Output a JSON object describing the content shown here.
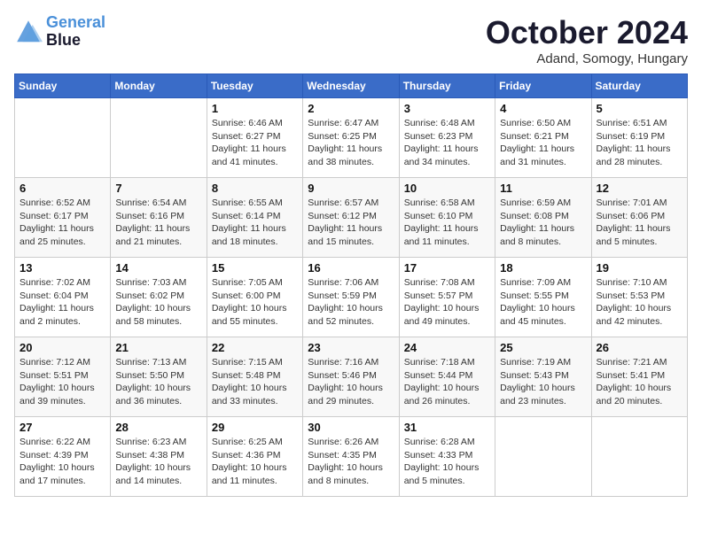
{
  "logo": {
    "line1": "General",
    "line2": "Blue"
  },
  "title": "October 2024",
  "location": "Adand, Somogy, Hungary",
  "headers": [
    "Sunday",
    "Monday",
    "Tuesday",
    "Wednesday",
    "Thursday",
    "Friday",
    "Saturday"
  ],
  "weeks": [
    [
      {
        "day": "",
        "info": ""
      },
      {
        "day": "",
        "info": ""
      },
      {
        "day": "1",
        "info": "Sunrise: 6:46 AM\nSunset: 6:27 PM\nDaylight: 11 hours and 41 minutes."
      },
      {
        "day": "2",
        "info": "Sunrise: 6:47 AM\nSunset: 6:25 PM\nDaylight: 11 hours and 38 minutes."
      },
      {
        "day": "3",
        "info": "Sunrise: 6:48 AM\nSunset: 6:23 PM\nDaylight: 11 hours and 34 minutes."
      },
      {
        "day": "4",
        "info": "Sunrise: 6:50 AM\nSunset: 6:21 PM\nDaylight: 11 hours and 31 minutes."
      },
      {
        "day": "5",
        "info": "Sunrise: 6:51 AM\nSunset: 6:19 PM\nDaylight: 11 hours and 28 minutes."
      }
    ],
    [
      {
        "day": "6",
        "info": "Sunrise: 6:52 AM\nSunset: 6:17 PM\nDaylight: 11 hours and 25 minutes."
      },
      {
        "day": "7",
        "info": "Sunrise: 6:54 AM\nSunset: 6:16 PM\nDaylight: 11 hours and 21 minutes."
      },
      {
        "day": "8",
        "info": "Sunrise: 6:55 AM\nSunset: 6:14 PM\nDaylight: 11 hours and 18 minutes."
      },
      {
        "day": "9",
        "info": "Sunrise: 6:57 AM\nSunset: 6:12 PM\nDaylight: 11 hours and 15 minutes."
      },
      {
        "day": "10",
        "info": "Sunrise: 6:58 AM\nSunset: 6:10 PM\nDaylight: 11 hours and 11 minutes."
      },
      {
        "day": "11",
        "info": "Sunrise: 6:59 AM\nSunset: 6:08 PM\nDaylight: 11 hours and 8 minutes."
      },
      {
        "day": "12",
        "info": "Sunrise: 7:01 AM\nSunset: 6:06 PM\nDaylight: 11 hours and 5 minutes."
      }
    ],
    [
      {
        "day": "13",
        "info": "Sunrise: 7:02 AM\nSunset: 6:04 PM\nDaylight: 11 hours and 2 minutes."
      },
      {
        "day": "14",
        "info": "Sunrise: 7:03 AM\nSunset: 6:02 PM\nDaylight: 10 hours and 58 minutes."
      },
      {
        "day": "15",
        "info": "Sunrise: 7:05 AM\nSunset: 6:00 PM\nDaylight: 10 hours and 55 minutes."
      },
      {
        "day": "16",
        "info": "Sunrise: 7:06 AM\nSunset: 5:59 PM\nDaylight: 10 hours and 52 minutes."
      },
      {
        "day": "17",
        "info": "Sunrise: 7:08 AM\nSunset: 5:57 PM\nDaylight: 10 hours and 49 minutes."
      },
      {
        "day": "18",
        "info": "Sunrise: 7:09 AM\nSunset: 5:55 PM\nDaylight: 10 hours and 45 minutes."
      },
      {
        "day": "19",
        "info": "Sunrise: 7:10 AM\nSunset: 5:53 PM\nDaylight: 10 hours and 42 minutes."
      }
    ],
    [
      {
        "day": "20",
        "info": "Sunrise: 7:12 AM\nSunset: 5:51 PM\nDaylight: 10 hours and 39 minutes."
      },
      {
        "day": "21",
        "info": "Sunrise: 7:13 AM\nSunset: 5:50 PM\nDaylight: 10 hours and 36 minutes."
      },
      {
        "day": "22",
        "info": "Sunrise: 7:15 AM\nSunset: 5:48 PM\nDaylight: 10 hours and 33 minutes."
      },
      {
        "day": "23",
        "info": "Sunrise: 7:16 AM\nSunset: 5:46 PM\nDaylight: 10 hours and 29 minutes."
      },
      {
        "day": "24",
        "info": "Sunrise: 7:18 AM\nSunset: 5:44 PM\nDaylight: 10 hours and 26 minutes."
      },
      {
        "day": "25",
        "info": "Sunrise: 7:19 AM\nSunset: 5:43 PM\nDaylight: 10 hours and 23 minutes."
      },
      {
        "day": "26",
        "info": "Sunrise: 7:21 AM\nSunset: 5:41 PM\nDaylight: 10 hours and 20 minutes."
      }
    ],
    [
      {
        "day": "27",
        "info": "Sunrise: 6:22 AM\nSunset: 4:39 PM\nDaylight: 10 hours and 17 minutes."
      },
      {
        "day": "28",
        "info": "Sunrise: 6:23 AM\nSunset: 4:38 PM\nDaylight: 10 hours and 14 minutes."
      },
      {
        "day": "29",
        "info": "Sunrise: 6:25 AM\nSunset: 4:36 PM\nDaylight: 10 hours and 11 minutes."
      },
      {
        "day": "30",
        "info": "Sunrise: 6:26 AM\nSunset: 4:35 PM\nDaylight: 10 hours and 8 minutes."
      },
      {
        "day": "31",
        "info": "Sunrise: 6:28 AM\nSunset: 4:33 PM\nDaylight: 10 hours and 5 minutes."
      },
      {
        "day": "",
        "info": ""
      },
      {
        "day": "",
        "info": ""
      }
    ]
  ]
}
